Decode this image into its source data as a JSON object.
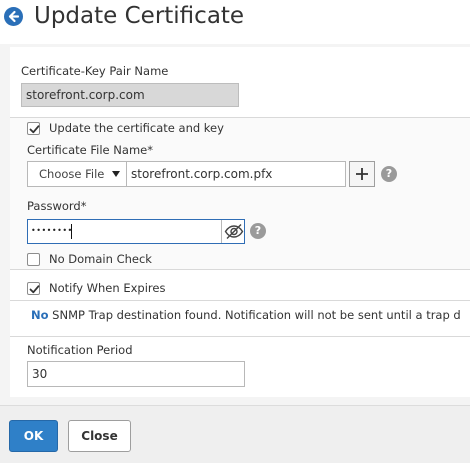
{
  "header": {
    "title": "Update Certificate",
    "back_icon": "arrow-left-circle-icon"
  },
  "form": {
    "cert_key_pair_name_label": "Certificate-Key Pair Name",
    "cert_key_pair_name_value": "storefront.corp.com",
    "update_cert_and_key": {
      "label": "Update the certificate and key",
      "checked": true
    },
    "cert_file_name_label": "Certificate File Name*",
    "choose_file_label": "Choose File",
    "cert_file_name_value": "storefront.corp.com.pfx",
    "password_label": "Password*",
    "password_masked": "••••••••",
    "no_domain_check": {
      "label": "No Domain Check",
      "checked": false
    },
    "notify_when_expires": {
      "label": "Notify When Expires",
      "checked": true
    },
    "snmp_no": "No",
    "snmp_message": " SNMP Trap destination found. Notification will not be sent until a trap d",
    "notification_period_label": "Notification Period",
    "notification_period_value": "30"
  },
  "footer": {
    "ok_label": "OK",
    "close_label": "Close"
  },
  "colors": {
    "accent_blue": "#2f80c8",
    "focus_border": "#2f6db5",
    "readonly_bg": "#d8d8d8"
  }
}
